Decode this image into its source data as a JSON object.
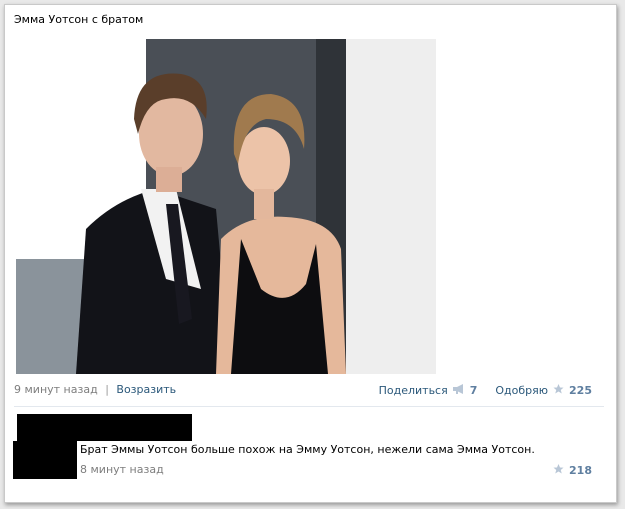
{
  "post": {
    "text": "Эмма Уотсон с братом",
    "time": "9 минут назад",
    "reply_link": "Возразить",
    "share_label": "Поделиться",
    "share_count": "7",
    "like_label": "Одобряю",
    "like_count": "225"
  },
  "comment": {
    "text": "Брат Эммы Уотсон больше похож на Эмму Уотсон, нежели сама Эмма Уотсон.",
    "time": "8 минут назад",
    "like_count": "218"
  },
  "colors": {
    "link": "#2b587a",
    "muted": "#7e7e7e",
    "like_star": "#b8c6d6"
  }
}
